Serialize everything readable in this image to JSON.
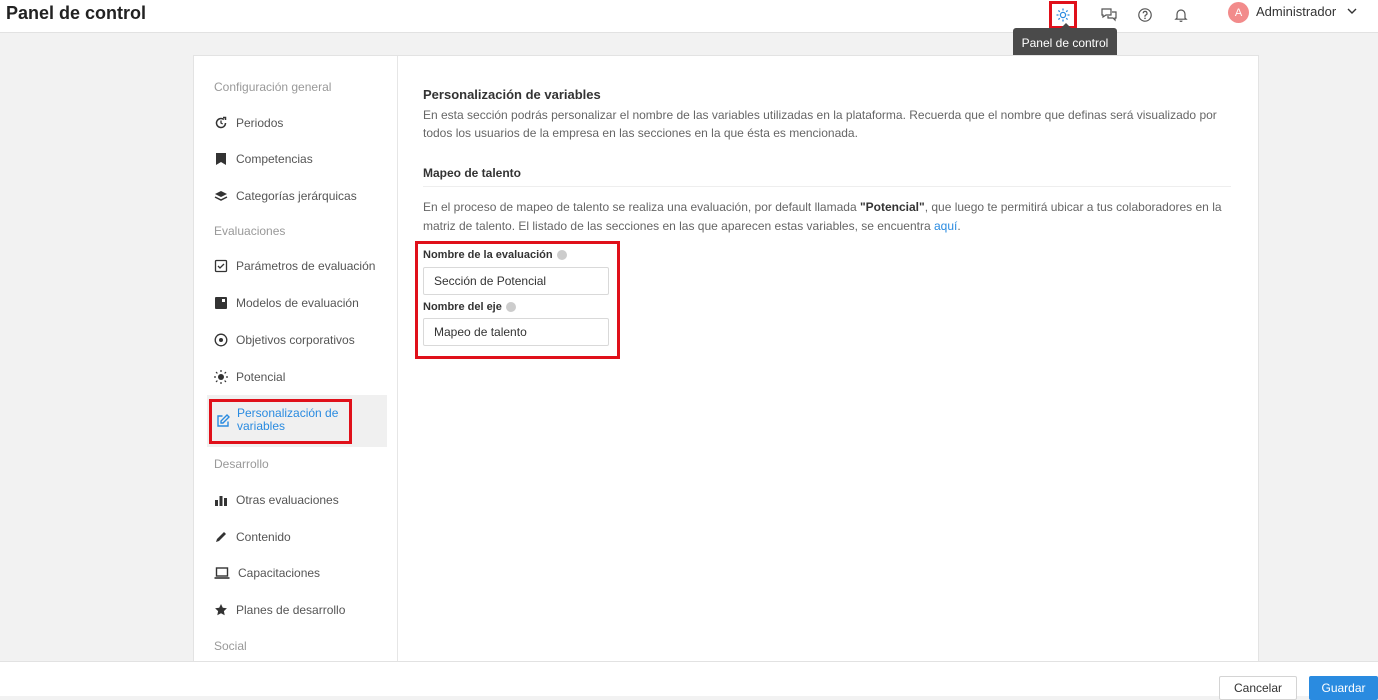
{
  "header": {
    "title": "Panel de control",
    "user_initial": "A",
    "user_name": "Administrador",
    "tooltip": "Panel de control"
  },
  "sidebar": {
    "sections": [
      {
        "label": "Configuración general"
      },
      {
        "label": "Evaluaciones"
      },
      {
        "label": "Desarrollo"
      },
      {
        "label": "Social"
      }
    ],
    "items": [
      {
        "label": "Periodos",
        "icon": "refresh-clock-icon"
      },
      {
        "label": "Competencias",
        "icon": "bookmark-icon"
      },
      {
        "label": "Categorías jerárquicas",
        "icon": "layers-icon"
      },
      {
        "label": "Parámetros de evaluación",
        "icon": "checkbox-icon"
      },
      {
        "label": "Modelos de evaluación",
        "icon": "square-icon"
      },
      {
        "label": "Objetivos corporativos",
        "icon": "target-icon"
      },
      {
        "label": "Potencial",
        "icon": "sun-icon"
      },
      {
        "label": "Personalización de variables",
        "icon": "edit-icon",
        "active": true
      },
      {
        "label": "Otras evaluaciones",
        "icon": "bar-chart-icon"
      },
      {
        "label": "Contenido",
        "icon": "pen-icon"
      },
      {
        "label": "Capacitaciones",
        "icon": "laptop-icon"
      },
      {
        "label": "Planes de desarrollo",
        "icon": "star-icon"
      }
    ]
  },
  "main": {
    "title": "Personalización de variables",
    "description": "En esta sección podrás personalizar el nombre de las variables utilizadas en la plataforma. Recuerda que el nombre que definas será visualizado por todos los usuarios de la empresa en las secciones en la que ésta es mencionada.",
    "subtitle": "Mapeo de talento",
    "info_pre": "En el proceso de mapeo de talento se realiza una evaluación, por default llamada ",
    "info_bold": "\"Potencial\"",
    "info_post": ", que luego te permitirá ubicar a tus colaboradores en la matriz de talento. El listado de las secciones en las que aparecen estas variables, se encuentra ",
    "info_link": "aquí",
    "info_end": ".",
    "fields": [
      {
        "label": "Nombre de la evaluación",
        "value": "Sección de Potencial"
      },
      {
        "label": "Nombre del eje",
        "value": "Mapeo de talento"
      }
    ]
  },
  "footer": {
    "cancel_label": "Cancelar",
    "save_label": "Guardar"
  },
  "colors": {
    "accent": "#2a8be0",
    "highlight": "#e0101a",
    "avatar": "#f28b8b"
  }
}
